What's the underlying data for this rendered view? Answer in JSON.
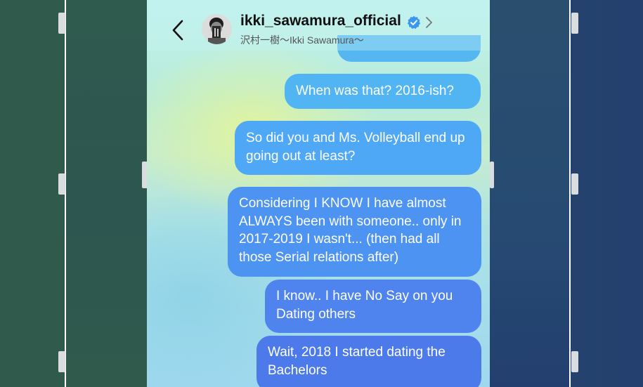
{
  "header": {
    "username": "ikki_sawamura_official",
    "display_name": "沢村一樹〜Ikki Sawamura〜",
    "verified": true,
    "icons": {
      "back": "chevron-left-icon",
      "verified": "verified-badge-icon",
      "profile": "chevron-right-icon",
      "avatar": "avatar"
    }
  },
  "messages": [
    {
      "text": ""
    },
    {
      "text": "When was that? 2016-ish?"
    },
    {
      "text": "So did you and Ms. Volleyball end up going out at least?"
    },
    {
      "text": "Considering I KNOW I have almost ALWAYS been with someone.. only in 2017-2019 I wasn't... (then had all those Serial relations after)"
    },
    {
      "text": "I know.. I have No Say on you Dating others"
    },
    {
      "text": "Wait, 2018 I started dating the Bachelors"
    }
  ],
  "colors": {
    "bubble_top": "#52b5f3",
    "bubble_bottom": "#4d7aeb",
    "verified": "#3897f0",
    "frame_left": "#2f5a4c",
    "frame_right": "#23406f"
  }
}
